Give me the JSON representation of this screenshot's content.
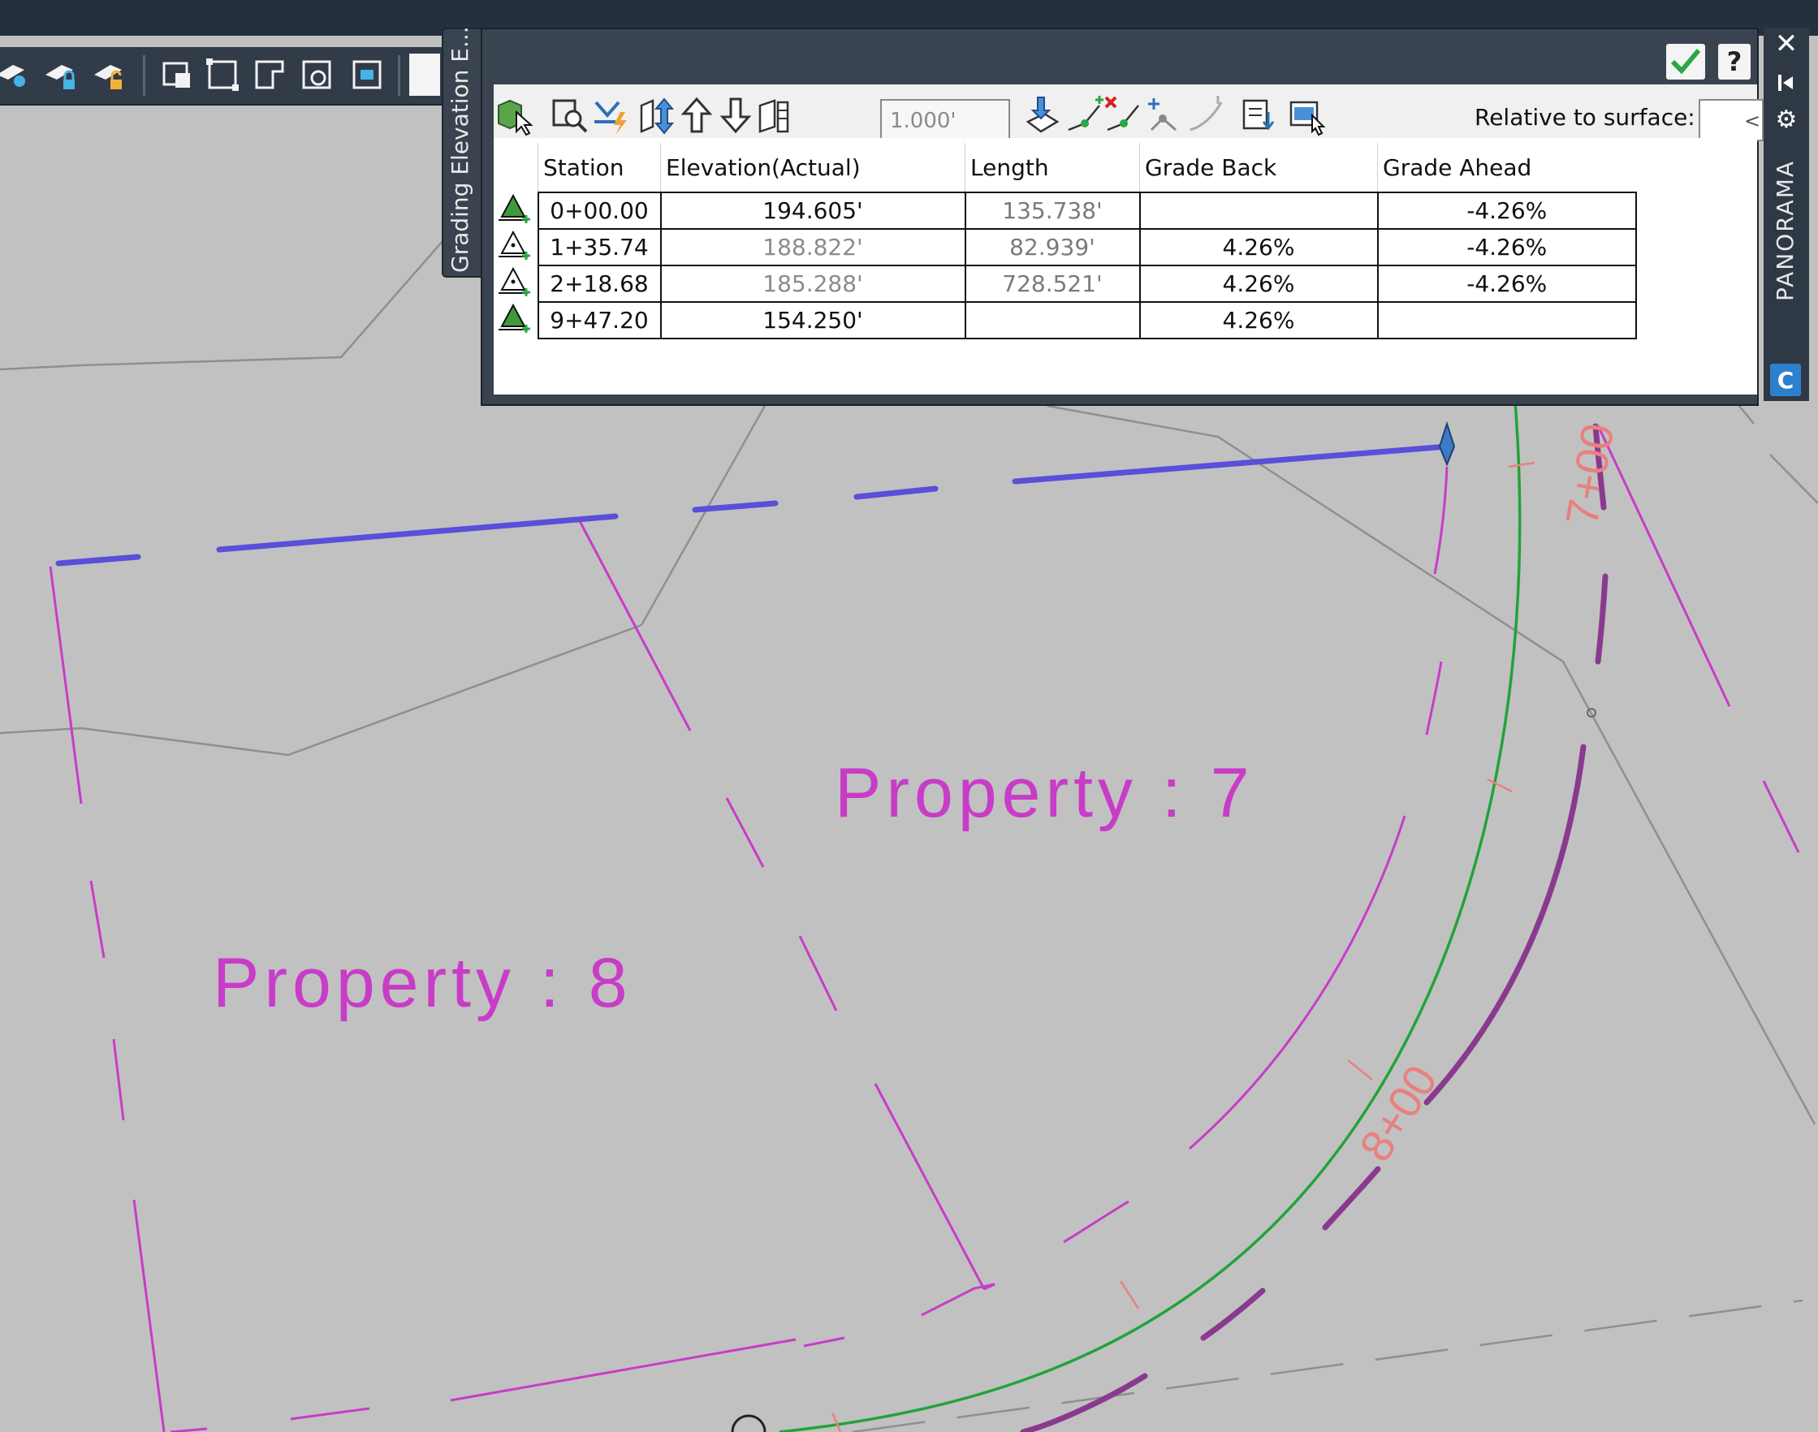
{
  "drawing": {
    "label_property7": "Property : 7",
    "label_property8": "Property : 8",
    "station_label_1": "7+00",
    "station_label_2": "8+00"
  },
  "side_tab": {
    "title": "Grading Elevation E..."
  },
  "panel": {
    "scale_value": "1.000'",
    "relative_label": "Relative to surface:",
    "relative_value": "<no",
    "help_glyph": "?"
  },
  "right_strip": {
    "label": "PANORAMA",
    "close_glyph": "✕",
    "gear_glyph": "⚙"
  },
  "grid": {
    "headers": [
      "Station",
      "Elevation(Actual)",
      "Length",
      "Grade Back",
      "Grade Ahead"
    ],
    "rows": [
      {
        "icon": "pi-green-icon",
        "station": "0+00.00",
        "elevation": "194.605'",
        "length": "135.738'",
        "grade_back": "",
        "grade_ahead": "-4.26%"
      },
      {
        "icon": "pi-outline-icon",
        "station": "1+35.74",
        "elevation": "188.822'",
        "length": "82.939'",
        "grade_back": "4.26%",
        "grade_ahead": "-4.26%"
      },
      {
        "icon": "pi-outline-icon",
        "station": "2+18.68",
        "elevation": "185.288'",
        "length": "728.521'",
        "grade_back": "4.26%",
        "grade_ahead": "-4.26%"
      },
      {
        "icon": "pi-green-icon",
        "station": "9+47.20",
        "elevation": "154.250'",
        "length": "",
        "grade_back": "4.26%",
        "grade_ahead": ""
      }
    ]
  },
  "colors": {
    "drawing_background": "#c1c1c1",
    "property_lines": "#c83cc8",
    "feature_line": "#5a4fd8",
    "alignment": "#22a33a",
    "station_text": "#e88080",
    "panel_dark": "#3a4350"
  }
}
